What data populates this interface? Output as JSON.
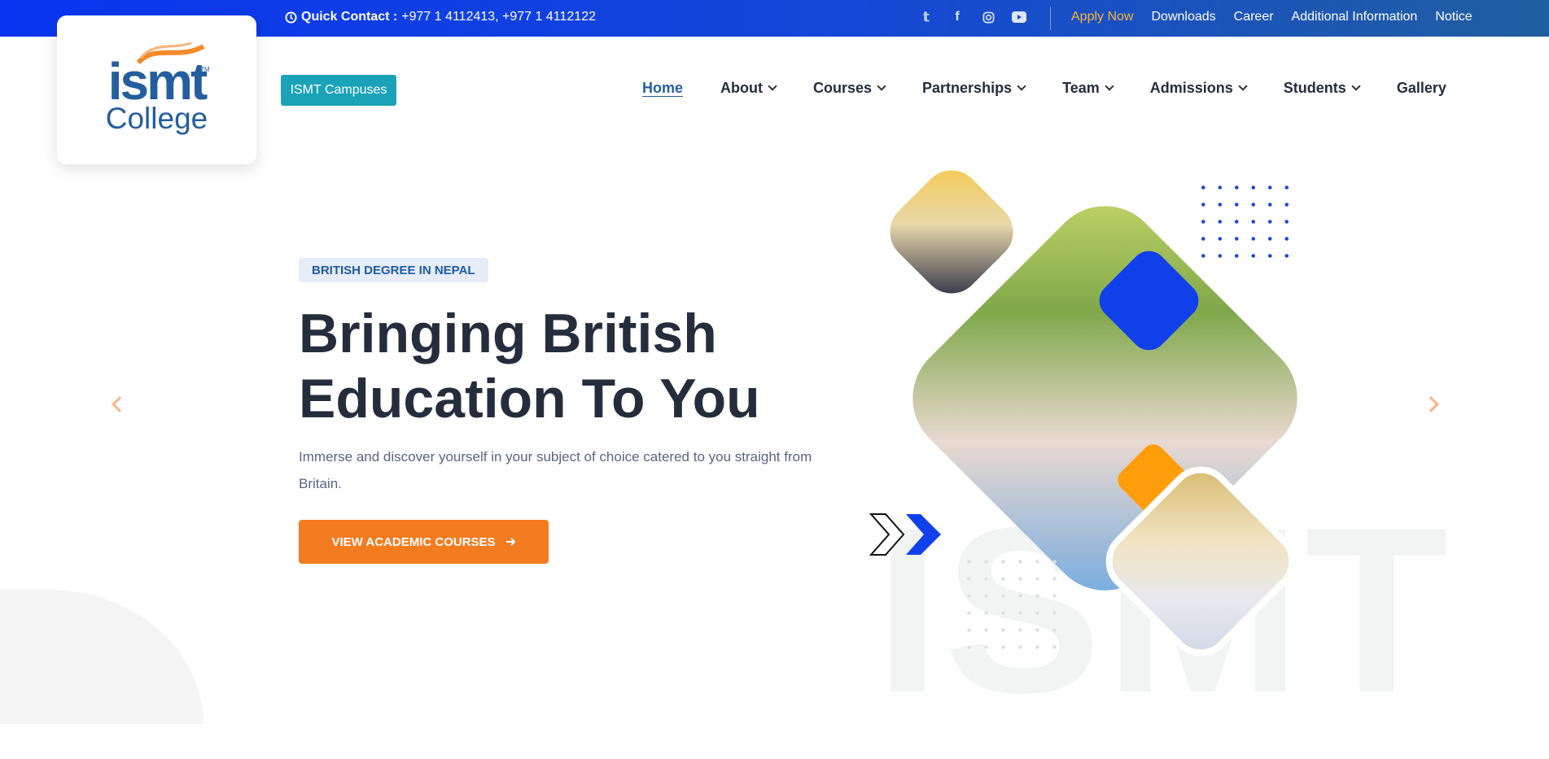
{
  "topbar": {
    "quick_contact_label": "Quick Contact :",
    "quick_contact_numbers": "+977 1 4112413, +977 1 4112122",
    "social": [
      "twitter-icon",
      "facebook-icon",
      "instagram-icon",
      "youtube-icon"
    ],
    "links": [
      "Apply Now",
      "Downloads",
      "Career",
      "Additional Information",
      "Notice"
    ]
  },
  "logo": {
    "brand": "ismt",
    "tm": "TM",
    "sub": "College"
  },
  "campuses_button": "ISMT Campuses",
  "nav": {
    "items": [
      {
        "label": "Home",
        "dropdown": false
      },
      {
        "label": "About",
        "dropdown": true
      },
      {
        "label": "Courses",
        "dropdown": true
      },
      {
        "label": "Partnerships",
        "dropdown": true
      },
      {
        "label": "Team",
        "dropdown": true
      },
      {
        "label": "Admissions",
        "dropdown": true
      },
      {
        "label": "Students",
        "dropdown": true
      },
      {
        "label": "Gallery",
        "dropdown": false
      }
    ]
  },
  "hero": {
    "badge": "BRITISH DEGREE IN NEPAL",
    "title_line1": "Bringing British",
    "title_line2": "Education To You",
    "description": "Immerse and discover yourself in your subject of choice catered to you straight from Britain.",
    "cta": "VIEW ACADEMIC COURSES",
    "watermark": "ISMT"
  },
  "colors": {
    "primary": "#0a35f0",
    "accent": "#f47c20",
    "teal": "#1aa3b8",
    "text": "#252d3d"
  }
}
